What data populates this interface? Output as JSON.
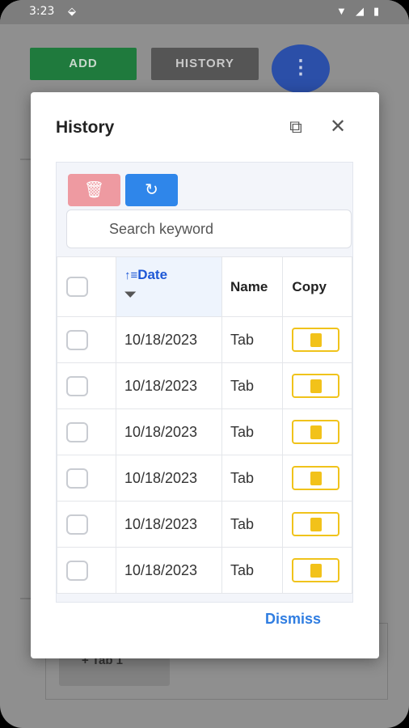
{
  "status_bar": {
    "time": "3:23",
    "icons": [
      "notification-icon",
      "wifi-icon",
      "signal-icon",
      "battery-icon"
    ]
  },
  "background_app": {
    "add_label": "ADD",
    "history_label": "HISTORY",
    "fab_label": "⋮",
    "tab_label": "+ Tab 1"
  },
  "dialog": {
    "title": "History",
    "search_placeholder": "Search keyword",
    "columns": [
      "Date",
      "Name",
      "Copy"
    ],
    "rows": [
      {
        "date": "10/18/2023",
        "name": "Tab"
      },
      {
        "date": "10/18/2023",
        "name": "Tab"
      },
      {
        "date": "10/18/2023",
        "name": "Tab"
      },
      {
        "date": "10/18/2023",
        "name": "Tab"
      },
      {
        "date": "10/18/2023",
        "name": "Tab"
      },
      {
        "date": "10/18/2023",
        "name": "Tab"
      }
    ],
    "dismiss_label": "Dismiss"
  },
  "colors": {
    "accent": "#2f86ea",
    "delete": "#ee9aa1",
    "copy": "#f0c31b",
    "add": "#1f7a3d"
  }
}
